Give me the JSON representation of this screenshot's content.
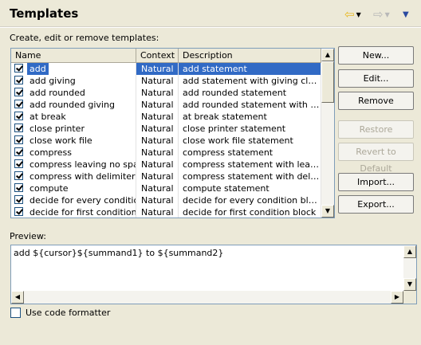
{
  "header": {
    "title": "Templates",
    "back_icon": "back-arrow-icon",
    "forward_icon": "forward-arrow-icon",
    "menu_icon": "view-menu-icon",
    "colors": {
      "back": "#e8b820",
      "forward": "#b0b0b0"
    }
  },
  "subtitle": "Create, edit or remove templates:",
  "table": {
    "columns": [
      "Name",
      "Context",
      "Description"
    ],
    "rows": [
      {
        "name": "add",
        "context": "Natural",
        "description": "add statement",
        "checked": true,
        "selected": true
      },
      {
        "name": "add giving",
        "context": "Natural",
        "description": "add statement with giving clause",
        "checked": true
      },
      {
        "name": "add rounded",
        "context": "Natural",
        "description": "add rounded statement",
        "checked": true
      },
      {
        "name": "add rounded giving",
        "context": "Natural",
        "description": "add rounded statement with giv...",
        "checked": true
      },
      {
        "name": "at break",
        "context": "Natural",
        "description": "at break statement",
        "checked": true
      },
      {
        "name": "close printer",
        "context": "Natural",
        "description": "close printer statement",
        "checked": true
      },
      {
        "name": "close work file",
        "context": "Natural",
        "description": "close work file statement",
        "checked": true
      },
      {
        "name": "compress",
        "context": "Natural",
        "description": "compress statement",
        "checked": true
      },
      {
        "name": "compress leaving no space",
        "context": "Natural",
        "description": "compress statement with leavin...",
        "checked": true
      },
      {
        "name": "compress with delimiter",
        "context": "Natural",
        "description": "compress statement with delimit...",
        "checked": true
      },
      {
        "name": "compute",
        "context": "Natural",
        "description": "compute statement",
        "checked": true
      },
      {
        "name": "decide for every condition",
        "context": "Natural",
        "description": "decide for every condition block",
        "checked": true
      },
      {
        "name": "decide for first condition",
        "context": "Natural",
        "description": "decide for first condition block",
        "checked": true
      }
    ]
  },
  "buttons": {
    "new": "New...",
    "edit": "Edit...",
    "remove": "Remove",
    "restore_removed": "Restore Removed",
    "revert_default": "Revert to Default",
    "import": "Import...",
    "export": "Export..."
  },
  "preview": {
    "label": "Preview:",
    "text": "add ${cursor}${summand1} to ${summand2}"
  },
  "options": {
    "use_code_formatter": "Use code formatter",
    "use_code_formatter_checked": false
  }
}
